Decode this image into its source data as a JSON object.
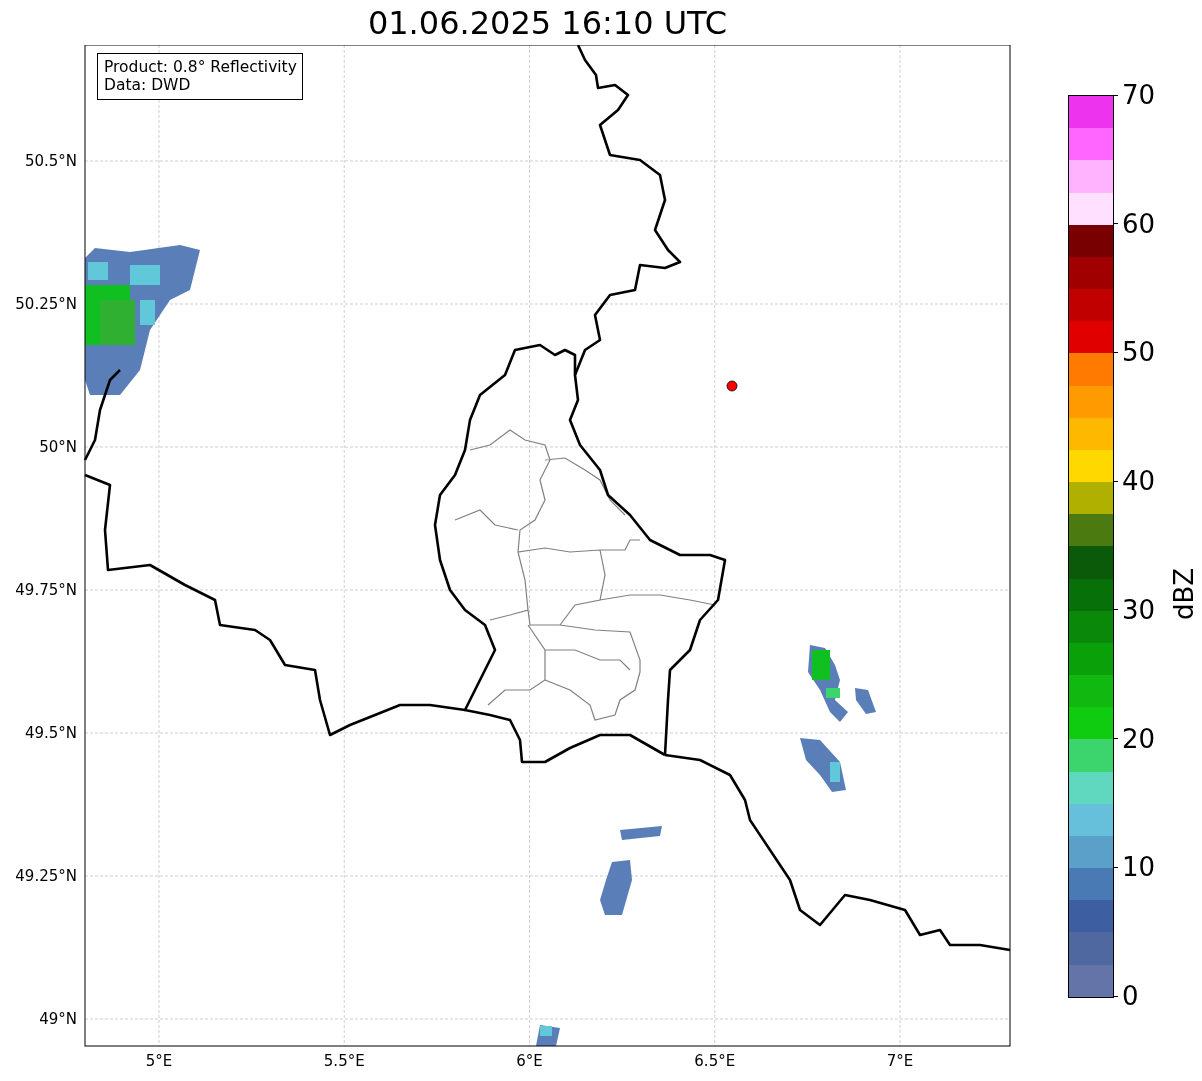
{
  "title": "01.06.2025 16:10 UTC",
  "info_box": [
    "Product: 0.8° Reflectivity",
    "Data: DWD"
  ],
  "lat_ticks": [
    "50.5°N",
    "50.25°N",
    "50°N",
    "49.75°N",
    "49.5°N",
    "49.25°N",
    "49°N"
  ],
  "lon_ticks": [
    "5°E",
    "5.5°E",
    "6°E",
    "6.5°E",
    "7°E"
  ],
  "colorbar": {
    "label": "dBZ",
    "ticks": [
      "70",
      "60",
      "50",
      "40",
      "30",
      "20",
      "10",
      "0"
    ],
    "segments": [
      {
        "color": "#ee33ee"
      },
      {
        "color": "#ff66ff"
      },
      {
        "color": "#ffb3ff"
      },
      {
        "color": "#ffe0ff"
      },
      {
        "color": "#780000"
      },
      {
        "color": "#a00000"
      },
      {
        "color": "#c00000"
      },
      {
        "color": "#e00000"
      },
      {
        "color": "#ff7a00"
      },
      {
        "color": "#ff9a00"
      },
      {
        "color": "#ffb800"
      },
      {
        "color": "#ffd800"
      },
      {
        "color": "#b0b000"
      },
      {
        "color": "#4a7a10"
      },
      {
        "color": "#0a5a0a"
      },
      {
        "color": "#087008"
      },
      {
        "color": "#0a880a"
      },
      {
        "color": "#0aa00a"
      },
      {
        "color": "#10b810"
      },
      {
        "color": "#10cc10"
      },
      {
        "color": "#3cd46c"
      },
      {
        "color": "#60d8c0"
      },
      {
        "color": "#66c0dc"
      },
      {
        "color": "#5aa0c8"
      },
      {
        "color": "#4a7ab4"
      },
      {
        "color": "#3e5ea2"
      },
      {
        "color": "#5068a0"
      },
      {
        "color": "#6474a8"
      }
    ]
  }
}
